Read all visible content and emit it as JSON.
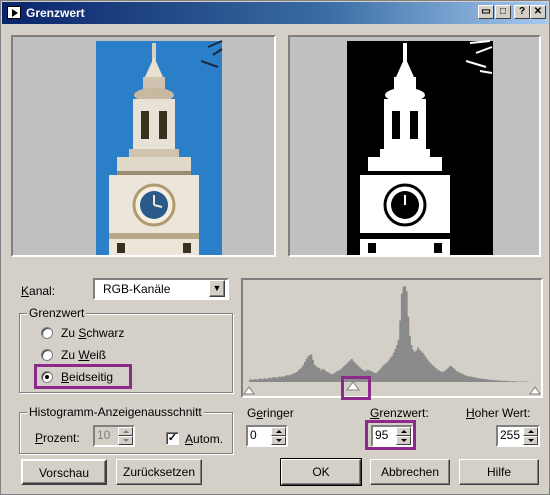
{
  "window": {
    "title": "Grenzwert",
    "buttons": [
      "restore",
      "maximize",
      "help",
      "close"
    ]
  },
  "channel": {
    "label": "Kanal:",
    "value": "RGB-Kanäle"
  },
  "threshold_group": {
    "label": "Grenzwert",
    "options": [
      {
        "label": "Zu Schwarz",
        "accel": "S",
        "selected": false
      },
      {
        "label": "Zu Weiß",
        "accel": "W",
        "selected": false
      },
      {
        "label": "Beidseitig",
        "accel": "B",
        "selected": true
      }
    ]
  },
  "histogram_group": {
    "label": "Histogramm-Anzeigenausschnitt",
    "percent_label": "Prozent:",
    "percent_value": "10",
    "auto_label": "Autom.",
    "auto_checked": true
  },
  "low": {
    "label": "Geringer",
    "value": "0"
  },
  "threshold": {
    "label": "Grenzwert:",
    "value": "95"
  },
  "high": {
    "label": "Hoher Wert:",
    "value": "255"
  },
  "buttons": {
    "preview": "Vorschau",
    "reset": "Zurücksetzen",
    "ok": "OK",
    "cancel": "Abbrechen",
    "help": "Hilfe"
  },
  "accent_color": "#8c2a8c",
  "histogram_bins": [
    6,
    7,
    5,
    8,
    7,
    6,
    9,
    8,
    7,
    10,
    8,
    9,
    11,
    10,
    12,
    13,
    12,
    11,
    14,
    13,
    15,
    14,
    16,
    18,
    17,
    19,
    20,
    22,
    24,
    26,
    30,
    34,
    38,
    44,
    52,
    60,
    66,
    70,
    72,
    58,
    45,
    40,
    38,
    36,
    30,
    34,
    32,
    28,
    26,
    24,
    22,
    20,
    22,
    25,
    28,
    30,
    32,
    36,
    40,
    44,
    48,
    52,
    56,
    60,
    55,
    50,
    46,
    42,
    38,
    34,
    31,
    28,
    30,
    32,
    30,
    28,
    26,
    24,
    22,
    26,
    30,
    35,
    40,
    45,
    48,
    52,
    56,
    62,
    68,
    76,
    86,
    96,
    110,
    160,
    230,
    248,
    250,
    236,
    170,
    120,
    96,
    84,
    78,
    82,
    90,
    84,
    80,
    76,
    70,
    64,
    58,
    52,
    48,
    44,
    40,
    36,
    32,
    30,
    28,
    26,
    28,
    30,
    34,
    38,
    42,
    40,
    36,
    32,
    28,
    26,
    24,
    22,
    20,
    18,
    16,
    15,
    14,
    14,
    13,
    12,
    11,
    10,
    10,
    9,
    8,
    8,
    7,
    7,
    6,
    6,
    5,
    5,
    5,
    4,
    4,
    4,
    3,
    3,
    3,
    3,
    2,
    2,
    2,
    2,
    2,
    1,
    1,
    1,
    1,
    1,
    1,
    1,
    1,
    0,
    0,
    0,
    0
  ]
}
